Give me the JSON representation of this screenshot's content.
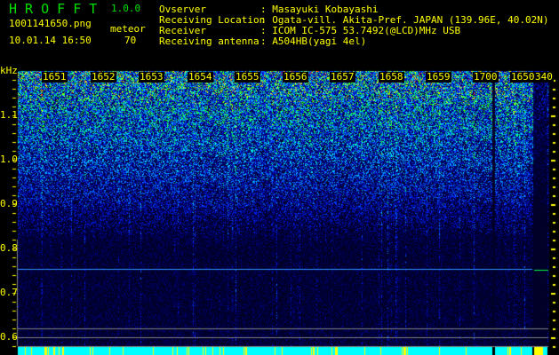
{
  "app": {
    "title": "H R O F F T",
    "version": "1.0.0"
  },
  "file": {
    "name": "1001141650.png",
    "datetime": "10.01.14 16:50"
  },
  "meteor": {
    "label": "meteor",
    "count": "70"
  },
  "info": {
    "rows": [
      {
        "label": "Ovserver",
        "value": ": Masayuki Kobayashi"
      },
      {
        "label": "Receiving Location",
        "value": ": Ogata-vill. Akita-Pref. JAPAN (139.96E, 40.02N)"
      },
      {
        "label": "Receiver",
        "value": ": ICOM IC-575 53.7492(@LCD)MHz USB"
      },
      {
        "label": "Receiving antenna",
        "value": ": A504HB(yagi 4el)"
      }
    ]
  },
  "chart_data": {
    "type": "heatmap",
    "ylabel": "kHz",
    "y_ticks": [
      "1.1",
      "1.0",
      "0.9",
      "0.8",
      "0.7",
      "0.6"
    ],
    "time_labels": [
      "1651",
      "1652",
      "1653",
      "1654",
      "1655",
      "1656",
      "1657",
      "1658",
      "1659",
      "1700",
      "1650",
      "340"
    ],
    "colors": [
      "#000060",
      "#0020ff",
      "#00c0ff",
      "#00ff60",
      "#ffff00",
      "#ff2000"
    ]
  }
}
